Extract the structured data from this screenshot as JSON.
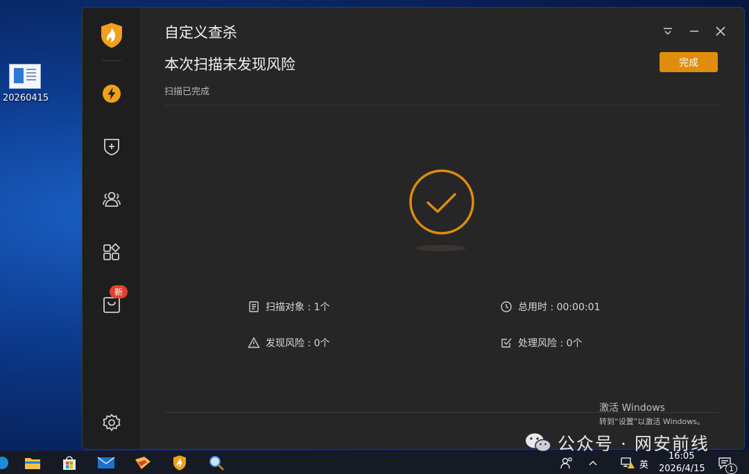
{
  "desktop": {
    "icon_label": "20260415"
  },
  "window": {
    "title": "自定义查杀",
    "headline": "本次扫描未发现风险",
    "subline": "扫描已完成",
    "done_button": "完成",
    "accent_color": "#e08c0d"
  },
  "sidebar": {
    "items": [
      {
        "icon": "lightning-icon"
      },
      {
        "icon": "shield-plus-icon"
      },
      {
        "icon": "users-icon"
      },
      {
        "icon": "apps-icon"
      },
      {
        "icon": "box-icon",
        "badge": "新"
      },
      {
        "icon": "gear-icon"
      }
    ]
  },
  "stats": {
    "scan_objects": "扫描对象 : 1个",
    "total_time": "总用时 : 00:00:01",
    "found_risk": "发现风险 : 0个",
    "handled_risk": "处理风险 : 0个"
  },
  "watermark": {
    "activate_title": "激活 Windows",
    "activate_sub": "转到“设置”以激活 Windows。",
    "wechat_label": "公众号 · 网安前线"
  },
  "taskbar": {
    "ime": "英",
    "time": "16:05",
    "date": "2026/4/15",
    "notification_count": "1"
  }
}
